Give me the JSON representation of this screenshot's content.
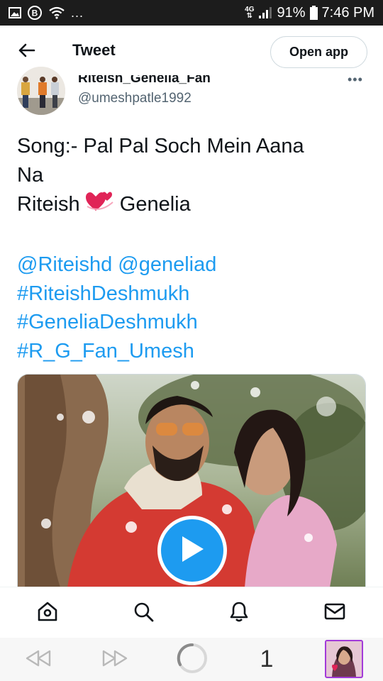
{
  "status_bar": {
    "more": "...",
    "network": "4G",
    "battery": "91%",
    "time": "7:46 PM"
  },
  "header": {
    "title": "Tweet",
    "open_app_label": "Open app"
  },
  "author": {
    "display_name": "Riteish_Genelia_Fan",
    "handle": "@umeshpatle1992",
    "more": "•••"
  },
  "tweet": {
    "line1": "Song:- Pal Pal Soch Mein Aana",
    "line2": "Na",
    "line3_before": "Riteish ",
    "line3_after": " Genelia",
    "mentions": [
      "@Riteishd",
      "@geneliad"
    ],
    "hashtags": [
      "#RiteishDeshmukh",
      "#GeneliaDeshmukh",
      "#R_G_Fan_Umesh"
    ]
  },
  "browser": {
    "tab_count": "1"
  },
  "colors": {
    "link": "#1d9bf0",
    "text": "#0f1419",
    "secondary": "#536471",
    "status_bar": "#1c1c1c"
  },
  "icons": {
    "nav": [
      "home-icon",
      "search-icon",
      "notifications-icon",
      "messages-icon"
    ],
    "browser": [
      "rewind-icon",
      "fast-forward-icon",
      "loading-icon"
    ]
  }
}
